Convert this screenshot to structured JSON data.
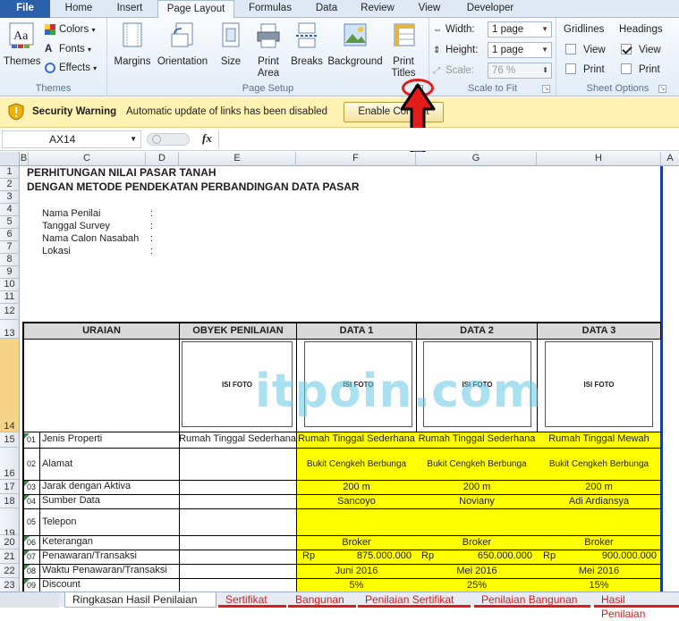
{
  "tabs": [
    "File",
    "Home",
    "Insert",
    "Page Layout",
    "Formulas",
    "Data",
    "Review",
    "View",
    "Developer"
  ],
  "active_tab": "Page Layout",
  "ribbon": {
    "themes": {
      "themes_label": "Themes",
      "colors_label": "Colors",
      "fonts_label": "Fonts",
      "effects_label": "Effects",
      "group_label": "Themes"
    },
    "page_setup": {
      "margins": "Margins",
      "orientation": "Orientation",
      "size": "Size",
      "print_area_1": "Print",
      "print_area_2": "Area",
      "breaks": "Breaks",
      "background": "Background",
      "print_titles_1": "Print",
      "print_titles_2": "Titles",
      "group_label": "Page Setup"
    },
    "scale_to_fit": {
      "width_label": "Width:",
      "width_value": "1 page",
      "height_label": "Height:",
      "height_value": "1 page",
      "scale_label": "Scale:",
      "scale_value": "76 %",
      "group_label": "Scale to Fit"
    },
    "sheet_options": {
      "gridlines_label": "Gridlines",
      "headings_label": "Headings",
      "view": "View",
      "print": "Print",
      "group_label": "Sheet Options",
      "gridlines_view": false,
      "gridlines_print": false,
      "headings_view": true,
      "headings_print": false
    }
  },
  "security": {
    "title": "Security Warning",
    "message": "Automatic update of links has been disabled",
    "button": "Enable Content"
  },
  "formula_bar": {
    "name_box": "AX14",
    "fx": "fx",
    "value": ""
  },
  "columns": [
    "B",
    "C",
    "D",
    "E",
    "F",
    "G",
    "H",
    "A"
  ],
  "rows": [
    "1",
    "2",
    "3",
    "4",
    "5",
    "6",
    "7",
    "8",
    "9",
    "10",
    "11",
    "12",
    "13",
    "14",
    "15",
    "16",
    "17",
    "18",
    "19",
    "20",
    "21",
    "22",
    "23"
  ],
  "sheet": {
    "title1": "PERHITUNGAN NILAI PASAR TANAH",
    "title2": "DENGAN METODE PENDEKATAN PERBANDINGAN DATA PASAR",
    "info": [
      {
        "label": "Nama Penilai",
        "sep": ":"
      },
      {
        "label": "Tanggal Survey",
        "sep": ":"
      },
      {
        "label": "Nama Calon Nasabah",
        "sep": ":"
      },
      {
        "label": "Lokasi",
        "sep": ":"
      }
    ],
    "headers": {
      "uraian": "URAIAN",
      "obyek": "OBYEK PENILAIAN",
      "data1": "DATA 1",
      "data2": "DATA 2",
      "data3": "DATA 3"
    },
    "photo_label": "ISI FOTO",
    "watermark": "itpoin.com",
    "table": [
      {
        "no": "01",
        "label": "Jenis Properti",
        "obyek": "Rumah Tinggal Sederhana",
        "d1": "Rumah Tinggal Sederhana",
        "d2": "Rumah Tinggal Sederhana",
        "d3": "Rumah Tinggal Mewah"
      },
      {
        "no": "02",
        "label": "Alamat",
        "obyek": "",
        "d1": "Bukit Cengkeh Berbunga",
        "d2": "Bukit Cengkeh Berbunga",
        "d3": "Bukit Cengkeh Berbunga"
      },
      {
        "no": "03",
        "label": "Jarak dengan Aktiva",
        "obyek": "",
        "d1": "200 m",
        "d2": "200 m",
        "d3": "200 m"
      },
      {
        "no": "04",
        "label": "Sumber Data",
        "obyek": "",
        "d1": "Sancoyo",
        "d2": "Noviany",
        "d3": "Adi Ardiansya"
      },
      {
        "no": "05",
        "label": "Telepon",
        "obyek": "",
        "d1": "",
        "d2": "",
        "d3": ""
      },
      {
        "no": "06",
        "label": "Keterangan",
        "obyek": "",
        "d1": "Broker",
        "d2": "Broker",
        "d3": "Broker"
      },
      {
        "no": "07",
        "label": "Penawaran/Transaksi",
        "obyek": "",
        "d1": "875.000.000",
        "d2": "650.000.000",
        "d3": "900.000.000",
        "currency": "Rp"
      },
      {
        "no": "08",
        "label": "Waktu Penawaran/Transaksi",
        "obyek": "",
        "d1": "Juni 2016",
        "d2": "Mei 2016",
        "d3": "Mei 2016"
      },
      {
        "no": "09",
        "label": "Discount",
        "obyek": "",
        "d1": "5%",
        "d2": "25%",
        "d3": "15%"
      }
    ]
  },
  "sheet_tabs": [
    "Ringkasan Hasil Penilaian",
    "Sertifikat",
    "Bangunan",
    "Penilaian Sertifikat",
    "Penilaian Bangunan",
    "Hasil Penilaian"
  ],
  "active_sheet": "Ringkasan Hasil Penilaian",
  "colors": {
    "accent": "#2a5faa",
    "highlight": "#ffff00",
    "annotation": "#e21b1b"
  }
}
